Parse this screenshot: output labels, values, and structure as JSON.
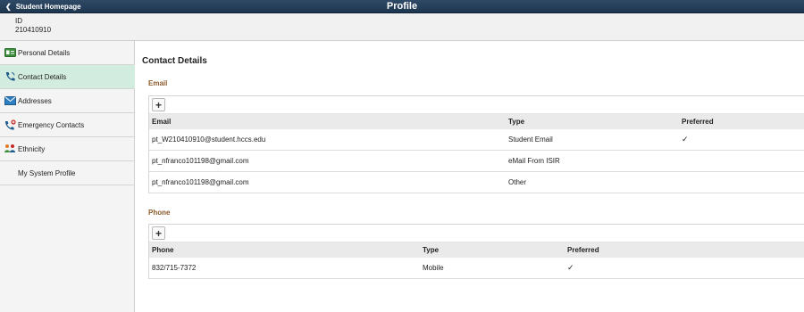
{
  "header": {
    "back_label": "Student Homepage",
    "title": "Profile"
  },
  "student": {
    "id_label": "ID",
    "id_value": "210410910"
  },
  "sidebar": {
    "items": [
      {
        "label": "Personal Details",
        "icon": "id-card-icon",
        "active": false
      },
      {
        "label": "Contact Details",
        "icon": "phone-icon",
        "active": true
      },
      {
        "label": "Addresses",
        "icon": "envelope-icon",
        "active": false
      },
      {
        "label": "Emergency Contacts",
        "icon": "emergency-phone-icon",
        "active": false
      },
      {
        "label": "Ethnicity",
        "icon": "people-icon",
        "active": false
      },
      {
        "label": "My System Profile",
        "icon": "",
        "active": false
      }
    ]
  },
  "main": {
    "section_title": "Contact Details",
    "email": {
      "group_title": "Email",
      "add_symbol": "+",
      "headers": {
        "email": "Email",
        "type": "Type",
        "preferred": "Preferred"
      },
      "rows": [
        {
          "email": "pt_W210410910@student.hccs.edu",
          "type": "Student Email",
          "preferred": "✓"
        },
        {
          "email": "pt_nfranco101198@gmail.com",
          "type": "eMail From ISIR",
          "preferred": ""
        },
        {
          "email": "pt_nfranco101198@gmail.com",
          "type": "Other",
          "preferred": ""
        }
      ]
    },
    "phone": {
      "group_title": "Phone",
      "add_symbol": "+",
      "headers": {
        "phone": "Phone",
        "type": "Type",
        "preferred": "Preferred"
      },
      "rows": [
        {
          "phone": "832/715-7372",
          "type": "Mobile",
          "preferred": "✓"
        }
      ]
    }
  },
  "colors": {
    "header_bg": "#1e3650",
    "active_nav_bg": "#d3ece0",
    "group_title": "#8a5a2b"
  }
}
